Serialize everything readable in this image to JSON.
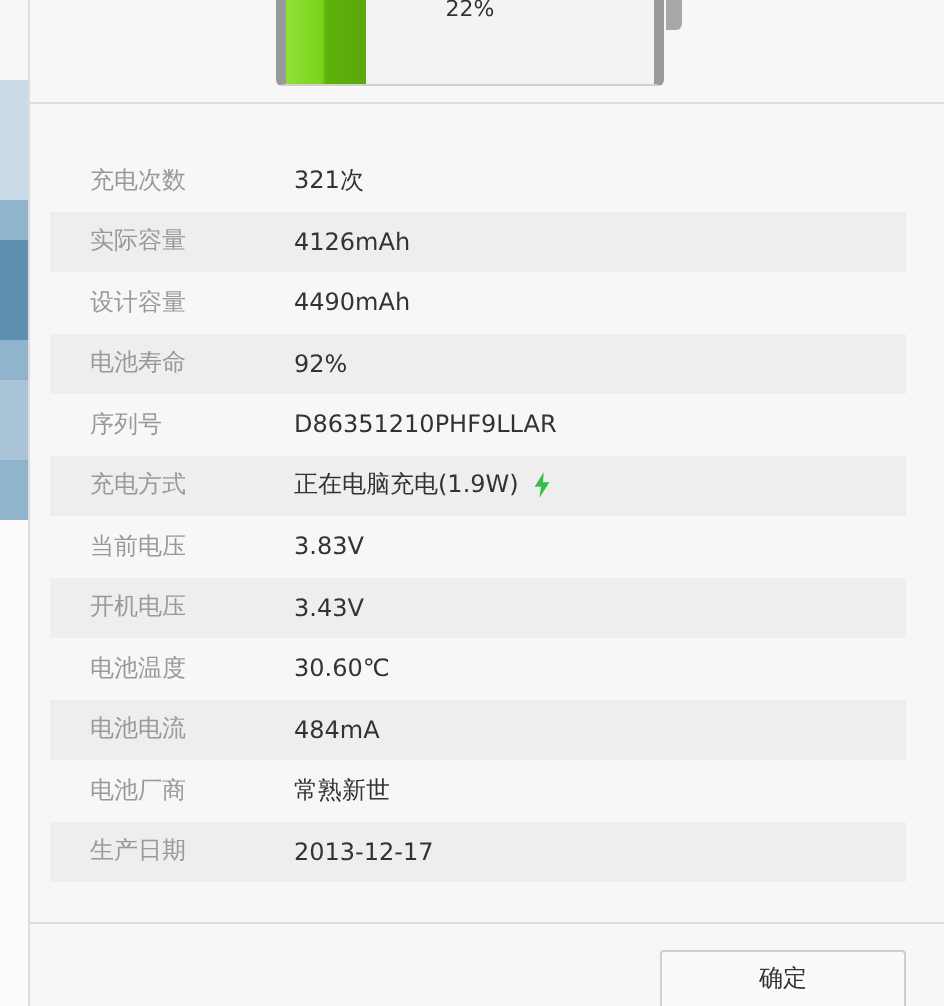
{
  "battery": {
    "label": "22%",
    "level": 0.22
  },
  "rows": [
    {
      "kind": "text",
      "label": "充电次数",
      "value": "321次"
    },
    {
      "kind": "text",
      "label": "实际容量",
      "value": "4126mAh"
    },
    {
      "kind": "text",
      "label": "设计容量",
      "value": "4490mAh"
    },
    {
      "kind": "text",
      "label": "电池寿命",
      "value": "92%"
    },
    {
      "kind": "text",
      "label": "序列号",
      "value": "D86351210PHF9LLAR"
    },
    {
      "kind": "charging",
      "label": "充电方式",
      "value": "正在电脑充电(1.9W)"
    },
    {
      "kind": "text",
      "label": "当前电压",
      "value": "3.83V"
    },
    {
      "kind": "text",
      "label": "开机电压",
      "value": "3.43V"
    },
    {
      "kind": "text",
      "label": "电池温度",
      "value": "30.60℃"
    },
    {
      "kind": "text",
      "label": "电池电流",
      "value": "484mA"
    },
    {
      "kind": "text",
      "label": "电池厂商",
      "value": "常熟新世"
    },
    {
      "kind": "text",
      "label": "生产日期",
      "value": "2013-12-17"
    }
  ],
  "buttons": [
    "确定"
  ]
}
